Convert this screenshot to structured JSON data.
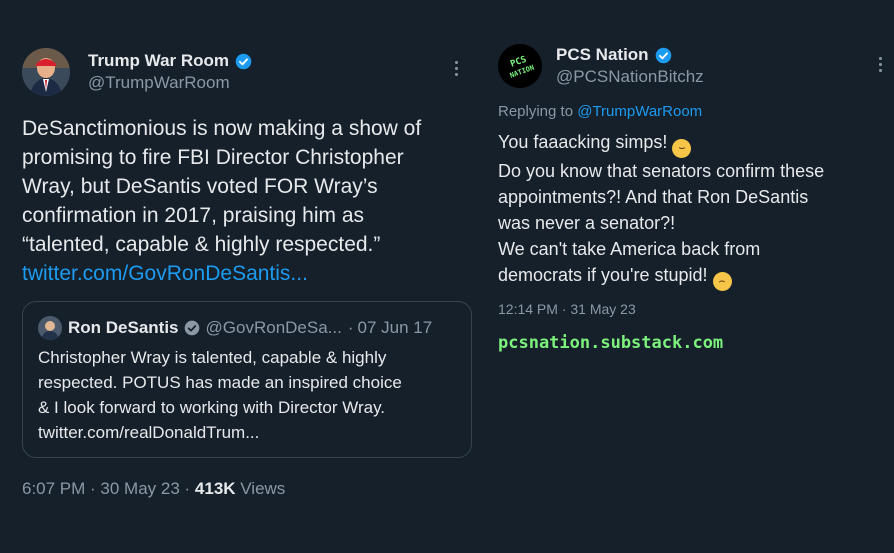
{
  "left": {
    "author": {
      "name": "Trump War Room",
      "handle": "@TrumpWarRoom"
    },
    "text_lines": [
      "DeSanctimonious is now making a show of",
      "promising to fire FBI Director Christopher",
      "Wray, but DeSantis voted FOR Wray’s",
      "confirmation in 2017, praising him as",
      "“talented, capable & highly respected.”"
    ],
    "link": "twitter.com/GovRonDeSantis...",
    "quote": {
      "name": "Ron DeSantis",
      "handle": "@GovRonDeSa...",
      "separator": "·",
      "date": "07 Jun 17",
      "text_lines": [
        "Christopher Wray is talented, capable & highly",
        "respected. POTUS has made an inspired choice",
        "& I look forward to working with Director Wray.",
        "twitter.com/realDonaldTrum..."
      ]
    },
    "meta": {
      "time_date": "6:07 PM · 30 May 23 · ",
      "views_count": "413K",
      "views_label": " Views"
    }
  },
  "right": {
    "author": {
      "name": "PCS Nation",
      "handle": "@PCSNationBitchz",
      "avatar_text": "PCS NATION"
    },
    "reply_prefix": "Replying to ",
    "reply_to": "@TrumpWarRoom",
    "text_lines": [
      "You faaacking simps!",
      "Do you know that senators confirm these",
      "appointments?! And that Ron DeSantis",
      "was never a senator?!",
      "We can't take America back from",
      "democrats if you're stupid!"
    ],
    "emoji_1": "persevering-face",
    "emoji_2": "worried-face",
    "meta": {
      "time_date": "12:14 PM · 31 May 23"
    },
    "footer_link": "pcsnation.substack.com"
  },
  "colors": {
    "background": "#15202b",
    "link": "#1d9bf0",
    "muted": "#8b98a5",
    "verified": "#1d9bf0",
    "substack": "#7cf27c"
  }
}
